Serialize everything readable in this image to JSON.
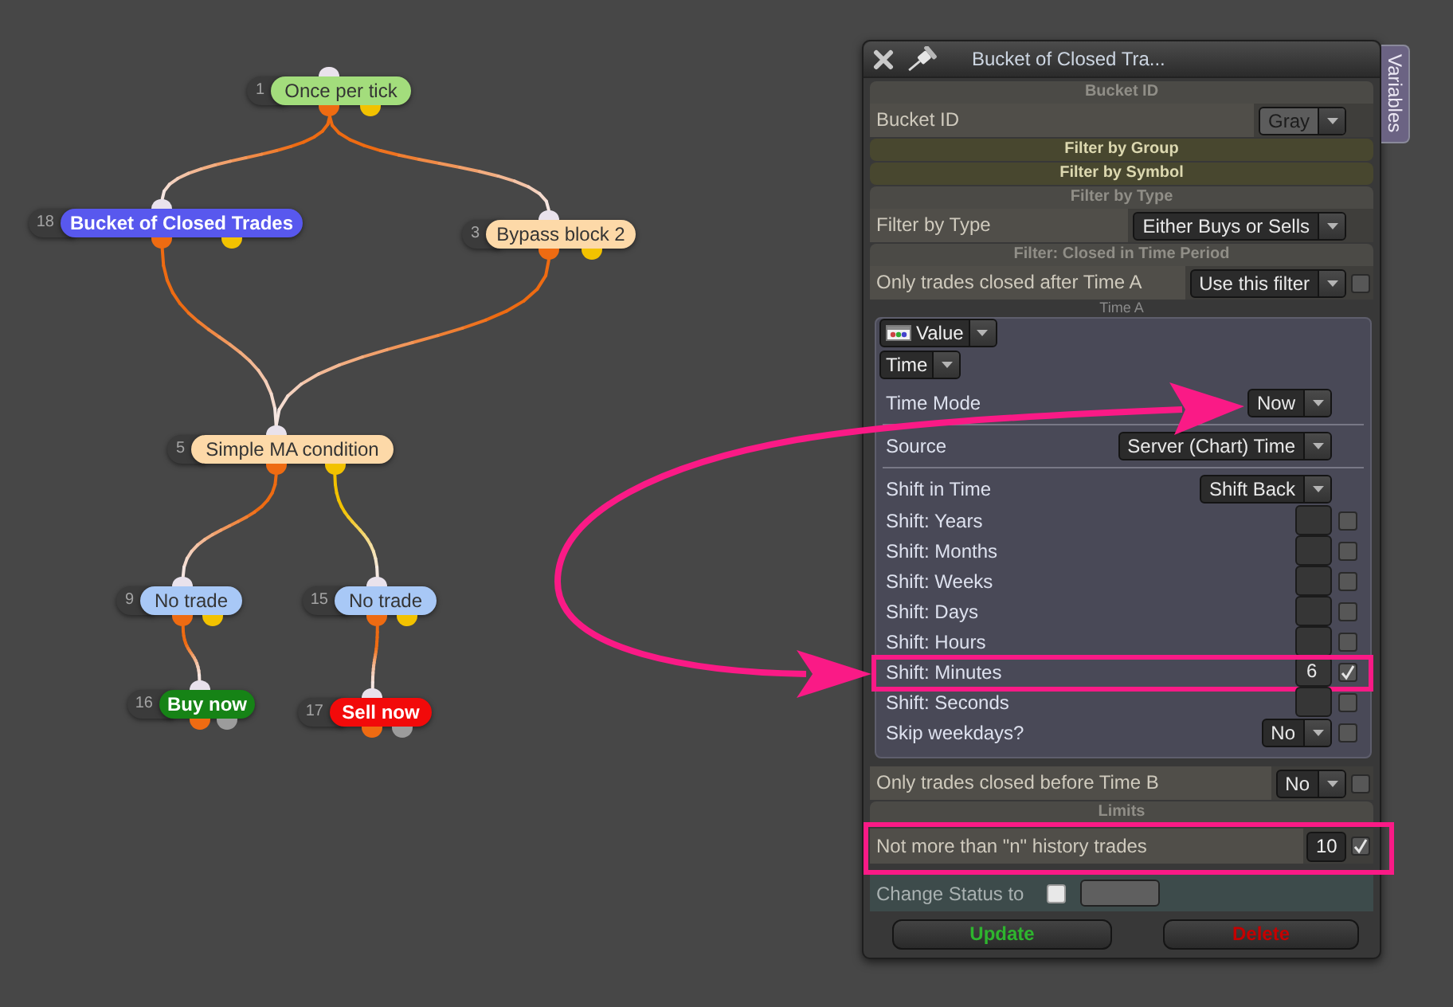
{
  "diagram": {
    "nodes": [
      {
        "number": "1",
        "label": "Once per tick",
        "color": "#a3dd7c",
        "outputs": [
          {
            "color": "#ee6b12"
          },
          {
            "color": "#f2c200"
          }
        ]
      },
      {
        "number": "18",
        "label": "Bucket of Closed Trades",
        "color": "#5858ee",
        "outputs": [
          {
            "color": "#ee6b12"
          },
          {
            "color": "#f2c200"
          }
        ]
      },
      {
        "number": "3",
        "label": "Bypass block 2",
        "color": "#fdd9a8",
        "outputs": [
          {
            "color": "#ee6b12"
          },
          {
            "color": "#f2c200"
          }
        ]
      },
      {
        "number": "5",
        "label": "Simple MA condition",
        "color": "#fdd9a8",
        "outputs": [
          {
            "color": "#ee6b12"
          },
          {
            "color": "#f2c200"
          }
        ]
      },
      {
        "number": "9",
        "label": "No trade",
        "color": "#a8c8f6",
        "outputs": [
          {
            "color": "#ee6b12"
          },
          {
            "color": "#f2c200"
          }
        ]
      },
      {
        "number": "15",
        "label": "No trade",
        "color": "#a8c8f6",
        "outputs": [
          {
            "color": "#ee6b12"
          },
          {
            "color": "#f2c200"
          }
        ]
      },
      {
        "number": "16",
        "label": "Buy now",
        "color": "#168316",
        "outputs": [
          {
            "color": "#ee6b12"
          },
          {
            "color": "#9c9c9c"
          }
        ]
      },
      {
        "number": "17",
        "label": "Sell now",
        "color": "#f20a0a",
        "outputs": [
          {
            "color": "#ee6b12"
          },
          {
            "color": "#9c9c9c"
          }
        ]
      }
    ]
  },
  "panel": {
    "title": "Bucket of Closed Tra...",
    "side_tab": "Variables",
    "sections": [
      {
        "kind": "header",
        "text": "Bucket ID"
      },
      {
        "kind": "dropdown",
        "label": "Bucket ID",
        "value": "Gray",
        "color": "#5c5c5c",
        "highlighted": false
      },
      {
        "kind": "group",
        "text": "Filter by Group"
      },
      {
        "kind": "group",
        "text": "Filter by Symbol"
      },
      {
        "kind": "header",
        "text": "Filter by Type"
      },
      {
        "kind": "dropdown",
        "label": "Filter by Type",
        "value": "Either Buys or Sells",
        "highlighted": false
      },
      {
        "kind": "header",
        "text": "Filter: Closed in Time Period"
      },
      {
        "kind": "dropdown",
        "label": "Only trades closed after Time A",
        "value": "Use this filter",
        "checked": false,
        "highlighted": false
      },
      {
        "kind": "caption",
        "text": "Time A"
      },
      {
        "kind": "subpanel",
        "selectors": [
          {
            "kind": "typed",
            "value": "Value"
          },
          {
            "kind": "plain",
            "value": "Time"
          }
        ],
        "rows": [
          {
            "kind": "dropdown",
            "label": "Time Mode",
            "value": "Now",
            "separated": true,
            "highlighted": false
          },
          {
            "kind": "dropdown",
            "label": "Source",
            "value": "Server (Chart) Time",
            "separated": true,
            "highlighted": false
          },
          {
            "kind": "dropdown",
            "label": "Shift in Time",
            "value": "Shift Back",
            "separated": false,
            "highlighted": false
          },
          {
            "kind": "number",
            "label": "Shift: Years",
            "checked": false,
            "separated": false,
            "highlighted": false
          },
          {
            "kind": "number",
            "label": "Shift: Months",
            "checked": false,
            "separated": false,
            "highlighted": false
          },
          {
            "kind": "number",
            "label": "Shift: Weeks",
            "checked": false,
            "separated": false,
            "highlighted": false
          },
          {
            "kind": "number",
            "label": "Shift: Days",
            "checked": false,
            "separated": false,
            "highlighted": false
          },
          {
            "kind": "number",
            "label": "Shift: Hours",
            "checked": false,
            "separated": false,
            "highlighted": false
          },
          {
            "kind": "number",
            "label": "Shift: Minutes",
            "value": "6",
            "checked": true,
            "separated": false,
            "highlighted": true
          },
          {
            "kind": "number",
            "label": "Shift: Seconds",
            "checked": false,
            "separated": false,
            "highlighted": false
          },
          {
            "kind": "dropdown",
            "label": "Skip weekdays?",
            "value": "No",
            "checked": false,
            "separated": false,
            "highlighted": false
          }
        ]
      },
      {
        "kind": "dropdown",
        "label": "Only trades closed before Time B",
        "value": "No",
        "checked": false,
        "highlighted": false
      },
      {
        "kind": "header",
        "text": "Limits"
      },
      {
        "kind": "number",
        "label": "Not more than \"n\" history trades",
        "value": "10",
        "checked": true,
        "highlighted": true
      },
      {
        "kind": "status",
        "label": "Change Status to",
        "checked": false
      }
    ],
    "buttons": [
      {
        "kind": "update",
        "label": "Update"
      },
      {
        "kind": "delete",
        "label": "Delete"
      }
    ]
  }
}
